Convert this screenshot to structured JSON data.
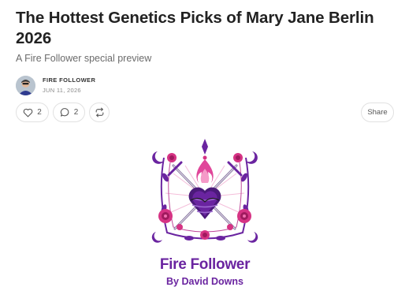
{
  "post": {
    "title": "The Hottest Genetics Picks of Mary Jane Berlin 2026",
    "subtitle": "A Fire Follower special preview",
    "author": "FIRE FOLLOWER",
    "date": "JUN 11, 2026"
  },
  "actions": {
    "like_count": "2",
    "comment_count": "2",
    "share_label": "Share"
  },
  "cover": {
    "title": "Fire Follower",
    "subtitle": "By David Downs",
    "colors": {
      "purple": "#6a24a0",
      "magenta": "#d63384",
      "pink": "#f06fb0"
    }
  }
}
